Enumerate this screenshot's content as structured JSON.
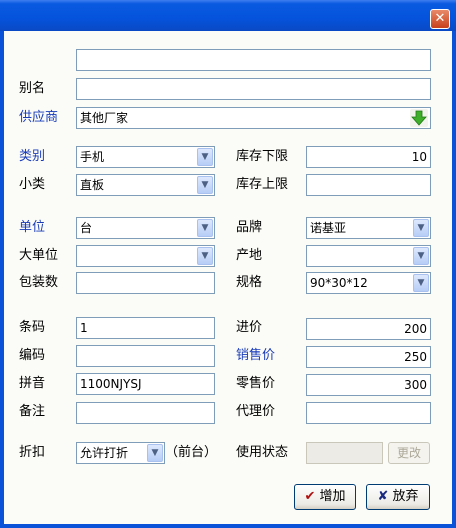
{
  "window": {
    "close_glyph": "✕"
  },
  "labels": {
    "alias": "别名",
    "supplier": "供应商",
    "category": "类别",
    "subcategory": "小类",
    "stock_lower": "库存下限",
    "stock_upper": "库存上限",
    "unit": "单位",
    "big_unit": "大单位",
    "package_count": "包装数",
    "brand": "品牌",
    "origin": "产地",
    "spec": "规格",
    "barcode": "条码",
    "code": "编码",
    "pinyin": "拼音",
    "remark": "备注",
    "purchase_price": "进价",
    "sale_price": "销售价",
    "retail_price": "零售价",
    "agent_price": "代理价",
    "discount": "折扣",
    "front_desk": "（前台）",
    "usage_status": "使用状态"
  },
  "values": {
    "name": "",
    "alias": "",
    "supplier": "其他厂家",
    "category": "手机",
    "subcategory": "直板",
    "stock_lower": "10",
    "stock_upper": "",
    "unit": "台",
    "big_unit": "",
    "package_count": "",
    "brand": "诺基亚",
    "origin": "",
    "spec": "90*30*12",
    "barcode": "1",
    "code": "",
    "pinyin": "1100NJYSJ",
    "remark": "",
    "purchase_price": "200",
    "sale_price": "250",
    "retail_price": "300",
    "agent_price": "",
    "discount": "允许打折",
    "usage_status": ""
  },
  "buttons": {
    "change": "更改",
    "add": "增加",
    "add_icon": "✔",
    "cancel": "放弃",
    "cancel_icon": "✘"
  },
  "colors": {
    "titlebar": "#0553dc",
    "label_blue": "#1a3cb8",
    "add_icon": "#b01010",
    "cancel_icon": "#1a2a80"
  }
}
